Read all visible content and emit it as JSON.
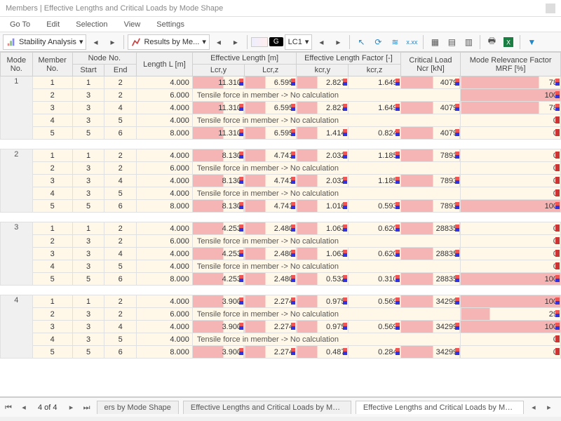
{
  "title": "Members | Effective Lengths and Critical Loads by Mode Shape",
  "menu": {
    "goto": "Go To",
    "edit": "Edit",
    "selection": "Selection",
    "view": "View",
    "settings": "Settings"
  },
  "toolbar": {
    "stability": "Stability Analysis",
    "results": "Results by Me...",
    "lc_badge": "G",
    "lc": "LC1"
  },
  "headers": {
    "mode": "Mode No.",
    "member": "Member No.",
    "node": "Node No.",
    "start": "Start",
    "end": "End",
    "length": "Length L [m]",
    "efflen": "Effective Length [m]",
    "lcry": "Lcr,y",
    "lcrz": "Lcr,z",
    "efffac": "Effective Length Factor [-]",
    "kcry": "kcr,y",
    "kcrz": "kcr,z",
    "crit": "Critical Load Ncr [kN]",
    "mrf": "Mode Relevance Factor MRF [%]"
  },
  "tensile": "Tensile force in member -> No calculation",
  "modes": [
    {
      "mode": 1,
      "rows": [
        {
          "m": 1,
          "s": 1,
          "e": 2,
          "L": "4.000",
          "ly": "11.310",
          "lz": "6.595",
          "ky": "2.827",
          "kz": "1.649",
          "ncr": "4079",
          "mrf": "78",
          "t": false
        },
        {
          "m": 2,
          "s": 3,
          "e": 2,
          "L": "6.000",
          "t": true,
          "mrf": "100"
        },
        {
          "m": 3,
          "s": 3,
          "e": 4,
          "L": "4.000",
          "ly": "11.310",
          "lz": "6.595",
          "ky": "2.827",
          "kz": "1.649",
          "ncr": "4079",
          "mrf": "78",
          "t": false
        },
        {
          "m": 4,
          "s": 3,
          "e": 5,
          "L": "4.000",
          "t": true,
          "mrf": "0"
        },
        {
          "m": 5,
          "s": 5,
          "e": 6,
          "L": "8.000",
          "ly": "11.310",
          "lz": "6.595",
          "ky": "1.414",
          "kz": "0.824",
          "ncr": "4079",
          "mrf": "0",
          "t": false
        }
      ]
    },
    {
      "mode": 2,
      "rows": [
        {
          "m": 1,
          "s": 1,
          "e": 2,
          "L": "4.000",
          "ly": "8.130",
          "lz": "4.741",
          "ky": "2.032",
          "kz": "1.185",
          "ncr": "7893",
          "mrf": "0",
          "t": false
        },
        {
          "m": 2,
          "s": 3,
          "e": 2,
          "L": "6.000",
          "t": true,
          "mrf": "0"
        },
        {
          "m": 3,
          "s": 3,
          "e": 4,
          "L": "4.000",
          "ly": "8.130",
          "lz": "4.741",
          "ky": "2.032",
          "kz": "1.185",
          "ncr": "7893",
          "mrf": "0",
          "t": false
        },
        {
          "m": 4,
          "s": 3,
          "e": 5,
          "L": "4.000",
          "t": true,
          "mrf": "0"
        },
        {
          "m": 5,
          "s": 5,
          "e": 6,
          "L": "8.000",
          "ly": "8.130",
          "lz": "4.741",
          "ky": "1.016",
          "kz": "0.593",
          "ncr": "7893",
          "mrf": "100",
          "t": false
        }
      ]
    },
    {
      "mode": 3,
      "rows": [
        {
          "m": 1,
          "s": 1,
          "e": 2,
          "L": "4.000",
          "ly": "4.253",
          "lz": "2.480",
          "ky": "1.063",
          "kz": "0.620",
          "ncr": "28835",
          "mrf": "0",
          "t": false
        },
        {
          "m": 2,
          "s": 3,
          "e": 2,
          "L": "6.000",
          "t": true,
          "mrf": "0"
        },
        {
          "m": 3,
          "s": 3,
          "e": 4,
          "L": "4.000",
          "ly": "4.253",
          "lz": "2.480",
          "ky": "1.063",
          "kz": "0.620",
          "ncr": "28835",
          "mrf": "0",
          "t": false
        },
        {
          "m": 4,
          "s": 3,
          "e": 5,
          "L": "4.000",
          "t": true,
          "mrf": "0"
        },
        {
          "m": 5,
          "s": 5,
          "e": 6,
          "L": "8.000",
          "ly": "4.253",
          "lz": "2.480",
          "ky": "0.532",
          "kz": "0.310",
          "ncr": "28835",
          "mrf": "100",
          "t": false
        }
      ]
    },
    {
      "mode": 4,
      "rows": [
        {
          "m": 1,
          "s": 1,
          "e": 2,
          "L": "4.000",
          "ly": "3.900",
          "lz": "2.274",
          "ky": "0.975",
          "kz": "0.569",
          "ncr": "34299",
          "mrf": "100",
          "t": false
        },
        {
          "m": 2,
          "s": 3,
          "e": 2,
          "L": "6.000",
          "t": true,
          "mrf": "29"
        },
        {
          "m": 3,
          "s": 3,
          "e": 4,
          "L": "4.000",
          "ly": "3.900",
          "lz": "2.274",
          "ky": "0.975",
          "kz": "0.569",
          "ncr": "34299",
          "mrf": "100",
          "t": false
        },
        {
          "m": 4,
          "s": 3,
          "e": 5,
          "L": "4.000",
          "t": true,
          "mrf": "0"
        },
        {
          "m": 5,
          "s": 5,
          "e": 6,
          "L": "8.000",
          "ly": "3.900",
          "lz": "2.274",
          "ky": "0.487",
          "kz": "0.284",
          "ncr": "34299",
          "mrf": "0",
          "t": false
        }
      ]
    }
  ],
  "footer": {
    "page": "4 of 4",
    "tab1": "ers by Mode Shape",
    "tab2": "Effective Lengths and Critical Loads by Member",
    "tab3": "Effective Lengths and Critical Loads by Mode Shape"
  }
}
